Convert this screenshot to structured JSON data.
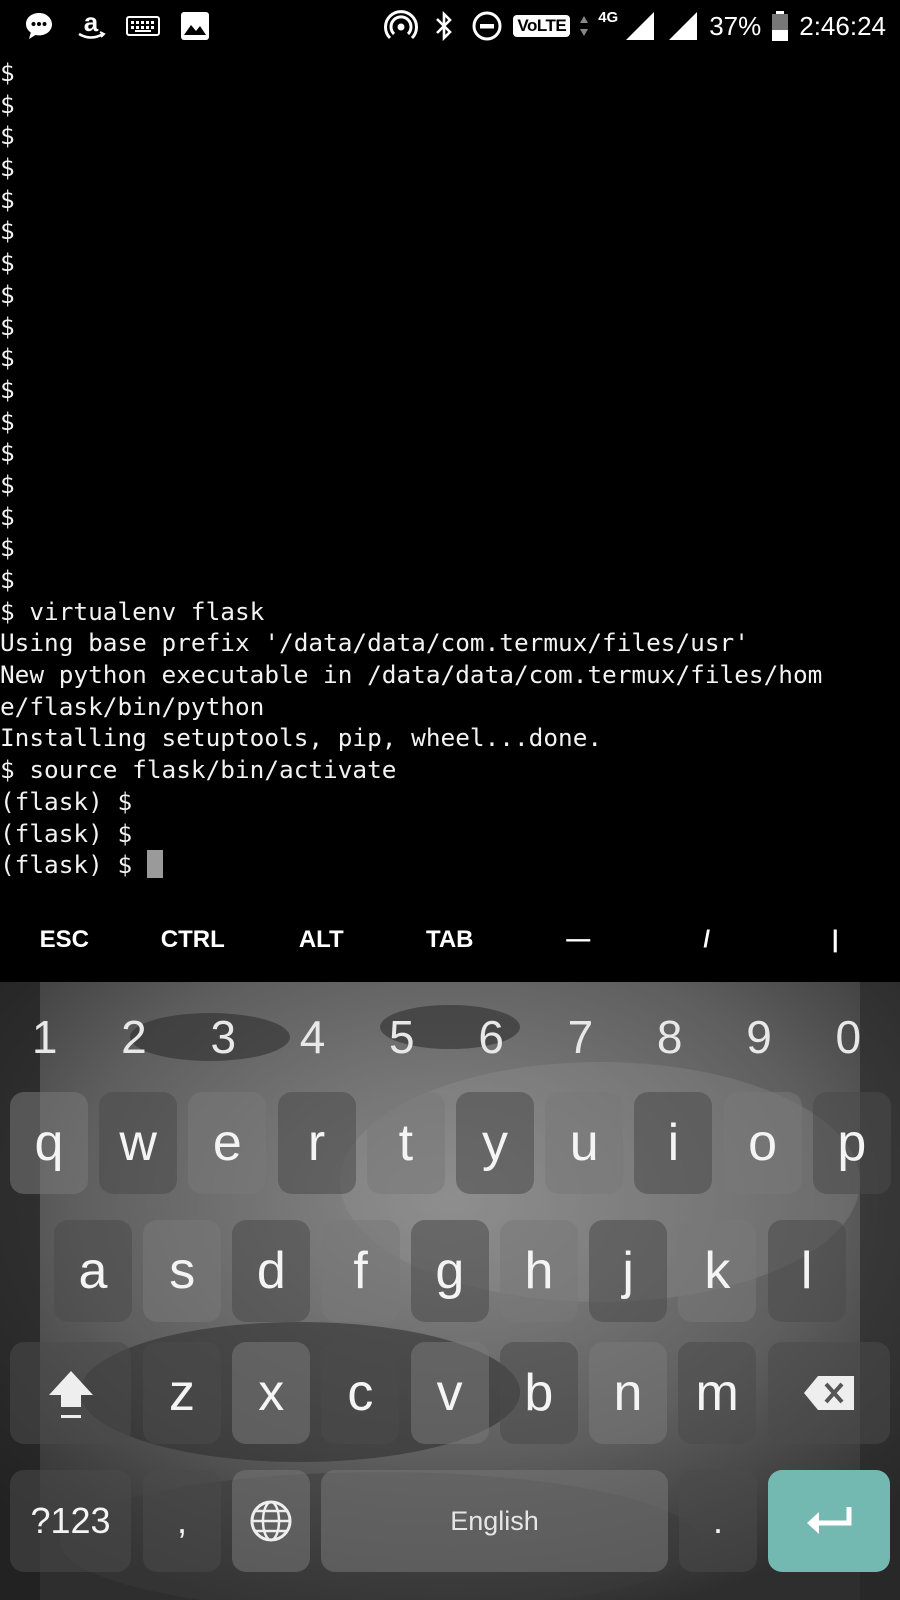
{
  "status_bar": {
    "battery": "37%",
    "time": "2:46:24",
    "volte": "VoLTE",
    "network": "4G"
  },
  "terminal": {
    "lines": [
      "$",
      "$",
      "$",
      "$",
      "$",
      "$",
      "$",
      "$",
      "$",
      "$",
      "$",
      "$",
      "$",
      "$",
      "$",
      "$",
      "$",
      "$ virtualenv flask",
      "Using base prefix '/data/data/com.termux/files/usr'",
      "New python executable in /data/data/com.termux/files/hom",
      "e/flask/bin/python",
      "Installing setuptools, pip, wheel...done.",
      "$ source flask/bin/activate",
      "(flask) $",
      "(flask) $"
    ],
    "current_prompt": "(flask) $ "
  },
  "extra_keys": [
    "ESC",
    "CTRL",
    "ALT",
    "TAB",
    "—",
    "/",
    "|"
  ],
  "keyboard": {
    "numbers": [
      "1",
      "2",
      "3",
      "4",
      "5",
      "6",
      "7",
      "8",
      "9",
      "0"
    ],
    "row1": [
      "q",
      "w",
      "e",
      "r",
      "t",
      "y",
      "u",
      "i",
      "o",
      "p"
    ],
    "row2": [
      "a",
      "s",
      "d",
      "f",
      "g",
      "h",
      "j",
      "k",
      "l"
    ],
    "row3": [
      "z",
      "x",
      "c",
      "v",
      "b",
      "n",
      "m"
    ],
    "symbols_label": "?123",
    "comma": ",",
    "period": ".",
    "space_label": "English"
  },
  "colors": {
    "terminal_bg": "#000000",
    "enter_key": "#74b9b1"
  }
}
